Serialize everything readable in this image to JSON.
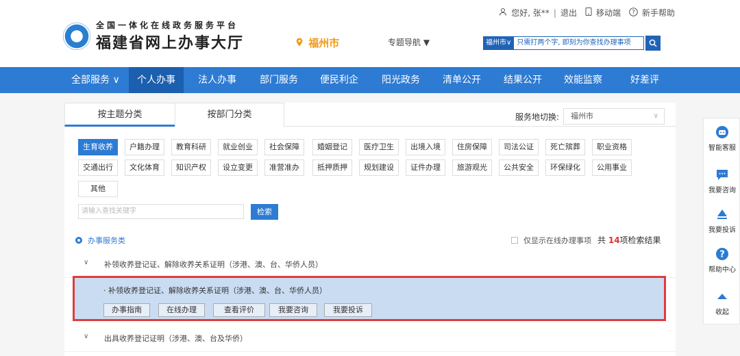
{
  "header": {
    "greeting": "您好, 张**",
    "logout": "退出",
    "mobile": "移动端",
    "help": "新手帮助",
    "logo_sub": "全国一体化在线政务服务平台",
    "logo_main": "福建省网上办事大厅",
    "city": "福州市",
    "topic_nav": "专题导航 ▼",
    "search_city": "福州市∨",
    "search_placeholder": "只需打两个字, 即刻为你查找办理事项"
  },
  "nav": {
    "items": [
      "全部服务 ∨",
      "个人办事",
      "法人办事",
      "部门服务",
      "便民利企",
      "阳光政务",
      "清单公开",
      "结果公开",
      "效能监察",
      "好差评"
    ],
    "active_index": 1
  },
  "tabs": {
    "by_topic": "按主题分类",
    "by_department": "按部门分类"
  },
  "location": {
    "label": "服务地切换:",
    "value": "福州市"
  },
  "tags": {
    "active_index": 0,
    "row1": [
      "生育收养",
      "户籍办理",
      "教育科研",
      "就业创业",
      "社会保障",
      "婚姻登记",
      "医疗卫生",
      "出境入境",
      "住房保障",
      "司法公证",
      "死亡殡葬",
      "职业资格"
    ],
    "row2": [
      "交通出行",
      "文化体育",
      "知识产权",
      "设立变更",
      "准营准办",
      "抵押质押",
      "规划建设",
      "证件办理",
      "旅游观光",
      "公共安全",
      "环保绿化",
      "公用事业"
    ],
    "row3": [
      "其他"
    ]
  },
  "keyword": {
    "placeholder": "请输入查找关键字",
    "button": "检索"
  },
  "results": {
    "service_type": "办事服务类",
    "online_only": "仅显示在线办理事项",
    "count_prefix": "共",
    "count": "14",
    "count_suffix": "项检索结果"
  },
  "items": [
    {
      "title": "补领收养登记证、解除收养关系证明（涉港、澳、台、华侨人员）"
    },
    {
      "title": "出具收养登记证明（涉港、澳、台及华侨）"
    }
  ],
  "expanded": {
    "title": "· 补领收养登记证、解除收养关系证明（涉港、澳、台、华侨人员）",
    "buttons": [
      "办事指南",
      "在线办理",
      "查看评价",
      "我要咨询",
      "我要投诉"
    ]
  },
  "float_menu": {
    "items": [
      {
        "label": "智能客服",
        "icon": "robot-icon"
      },
      {
        "label": "我要咨询",
        "icon": "chat-icon"
      },
      {
        "label": "我要投诉",
        "icon": "complaint-icon"
      },
      {
        "label": "帮助中心",
        "icon": "help-icon"
      },
      {
        "label": "收起",
        "icon": "collapse-icon"
      }
    ]
  },
  "colors": {
    "primary": "#2d7bd3",
    "nav_active": "#1b5fae",
    "city": "#f39a11",
    "highlight_border": "#e03c3c",
    "highlight_bg": "#c9dcf2"
  }
}
